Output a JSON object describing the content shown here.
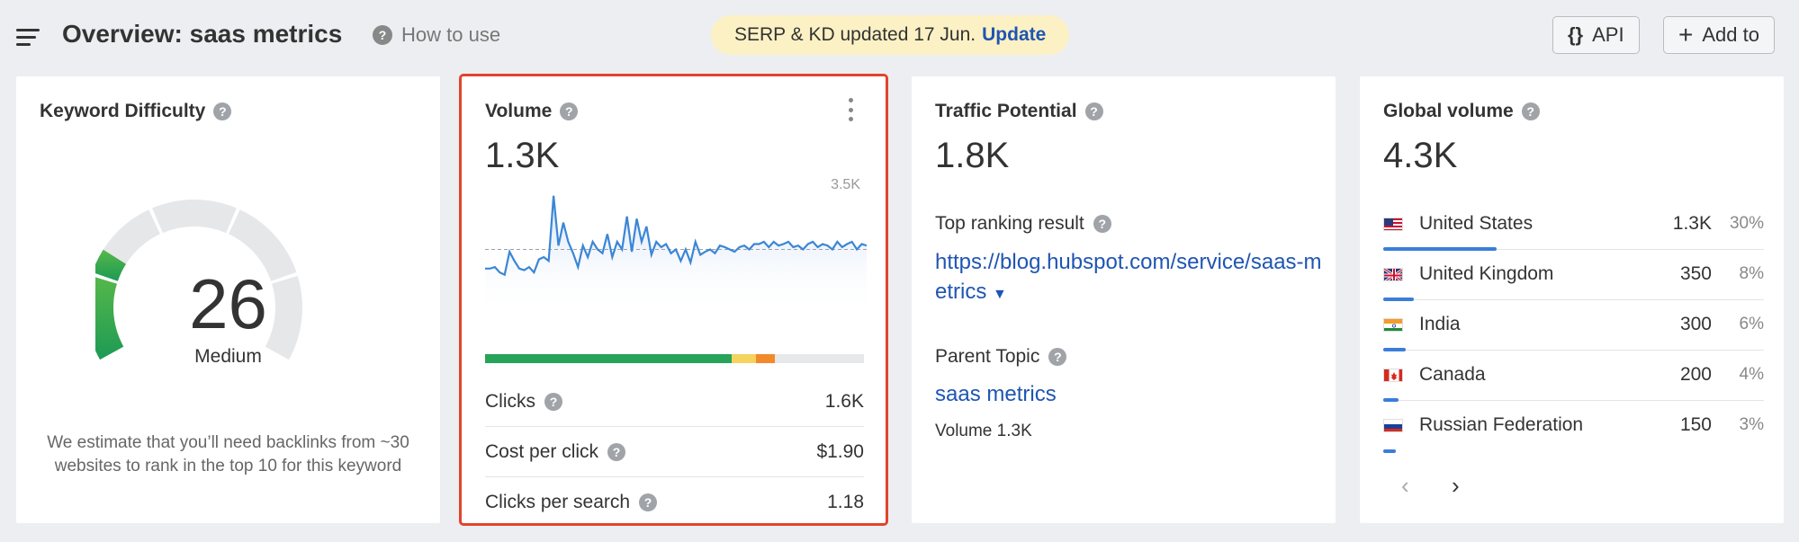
{
  "header": {
    "title": "Overview: saas metrics",
    "how_to_label": "How to use",
    "notice_text": "SERP & KD updated 17 Jun.",
    "notice_link": "Update",
    "api_label": "API",
    "add_label": "Add to"
  },
  "kd_card": {
    "title": "Keyword Difficulty",
    "score": "26",
    "level": "Medium",
    "description": "We estimate that you’ll need backlinks from ~30 websites to rank in the top 10 for this keyword",
    "level_fraction": 0.26,
    "gauge_color": "#1d9a55"
  },
  "volume_card": {
    "title": "Volume",
    "value": "1.3K",
    "trend_max_label": "3.5K",
    "trend_series": [
      0.6,
      0.6,
      0.62,
      0.55,
      0.52,
      0.82,
      0.7,
      0.6,
      0.58,
      0.62,
      0.55,
      0.72,
      0.75,
      0.7,
      1.55,
      0.9,
      1.2,
      0.95,
      0.8,
      0.62,
      0.9,
      0.75,
      0.95,
      0.85,
      0.8,
      1.05,
      0.75,
      0.95,
      0.85,
      1.28,
      0.82,
      1.25,
      0.95,
      1.15,
      0.78,
      0.95,
      0.88,
      0.92,
      0.8,
      0.85,
      0.7,
      0.85,
      0.68,
      0.95,
      0.78,
      0.82,
      0.85,
      0.8,
      0.9,
      0.88,
      0.85,
      0.82,
      0.88,
      0.9,
      0.85,
      0.92,
      0.92,
      0.95,
      0.88,
      0.95,
      0.9,
      0.92,
      0.95,
      0.88,
      0.9,
      0.85,
      0.92,
      0.95,
      0.88,
      0.92,
      0.9,
      0.85,
      0.95,
      0.88,
      0.92,
      0.95,
      0.85,
      0.92,
      0.9
    ],
    "distribution": [
      {
        "fraction": 0.65,
        "color": "#27a35a"
      },
      {
        "fraction": 0.065,
        "color": "#f4d35e"
      },
      {
        "fraction": 0.05,
        "color": "#f28a2c"
      },
      {
        "fraction": 0.235,
        "color": "#e7e8ea"
      }
    ],
    "stats": [
      {
        "label": "Clicks",
        "value": "1.6K"
      },
      {
        "label": "Cost per click",
        "value": "$1.90"
      },
      {
        "label": "Clicks per search",
        "value": "1.18"
      }
    ]
  },
  "tp_card": {
    "title": "Traffic Potential",
    "value": "1.8K",
    "top_result_label": "Top ranking result",
    "top_result_url": "https://blog.hubspot.com/service/saas-metrics",
    "parent_topic_label": "Parent Topic",
    "parent_topic": "saas metrics",
    "parent_volume": "Volume 1.3K"
  },
  "gv_card": {
    "title": "Global volume",
    "value": "4.3K",
    "countries": [
      {
        "name": "United States",
        "volume": "1.3K",
        "pct": "30%",
        "flag": "flag-us-icon",
        "share": 0.3
      },
      {
        "name": "United Kingdom",
        "volume": "350",
        "pct": "8%",
        "flag": "flag-uk-icon",
        "share": 0.08
      },
      {
        "name": "India",
        "volume": "300",
        "pct": "6%",
        "flag": "flag-in-icon",
        "share": 0.06
      },
      {
        "name": "Canada",
        "volume": "200",
        "pct": "4%",
        "flag": "flag-ca-icon",
        "share": 0.04
      },
      {
        "name": "Russian Federation",
        "volume": "150",
        "pct": "3%",
        "flag": "flag-ru-icon",
        "share": 0.03
      }
    ],
    "prev_glyph": "‹",
    "next_glyph": "›"
  }
}
